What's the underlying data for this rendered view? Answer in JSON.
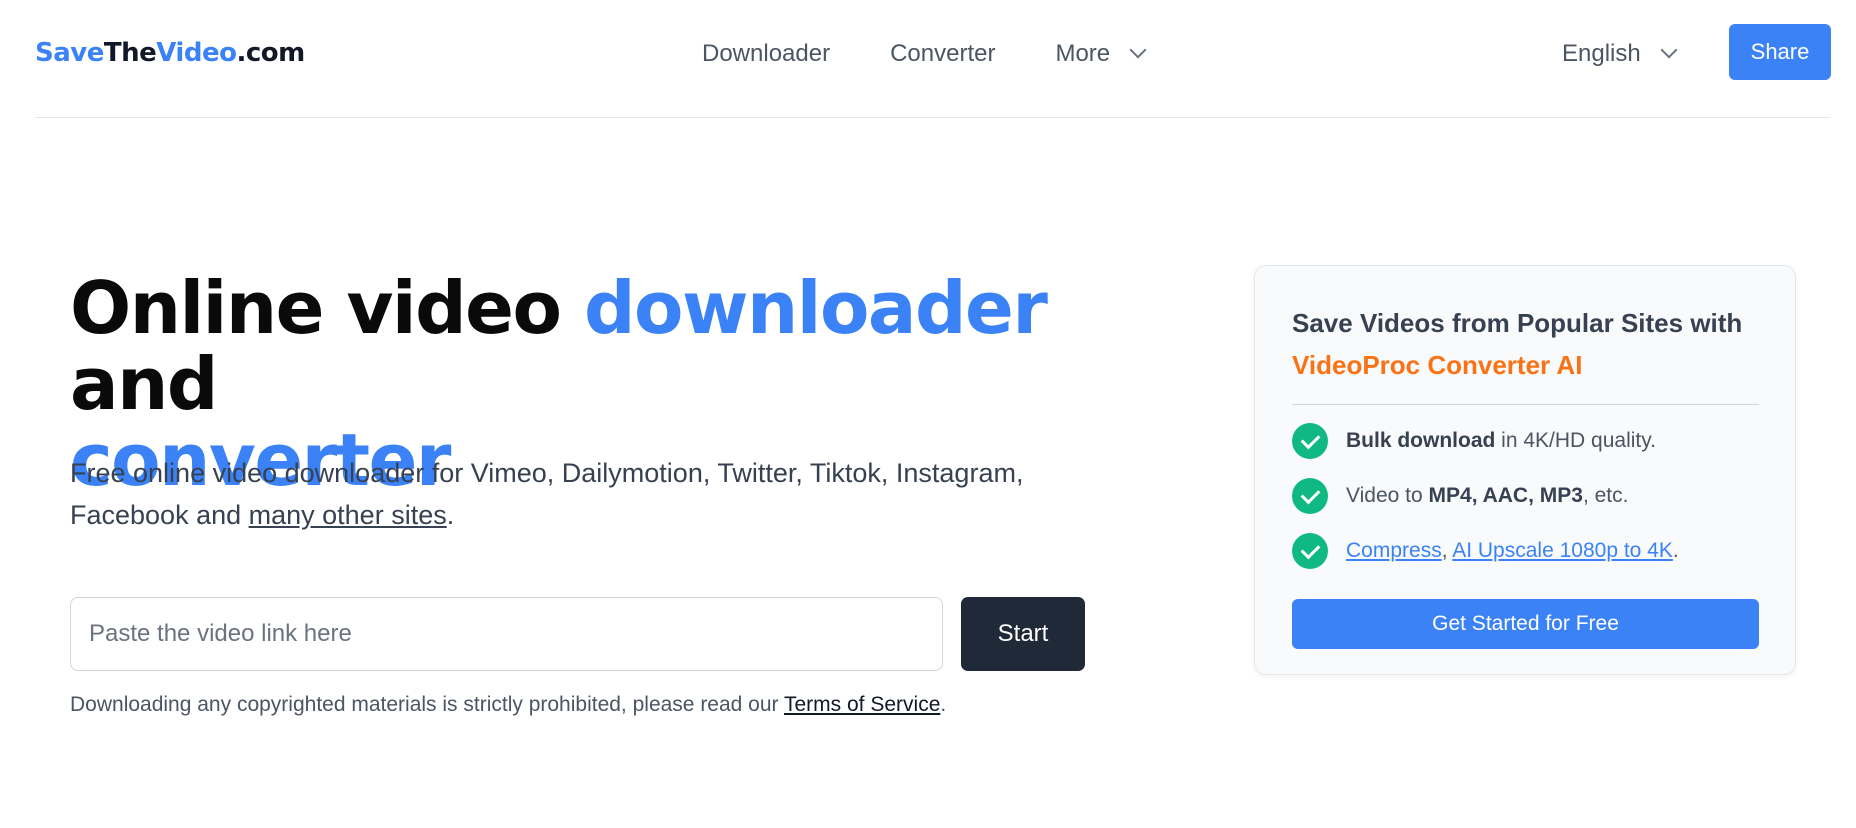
{
  "header": {
    "logo": {
      "part1": "Save",
      "part2": "The",
      "part3": "Video",
      "part4": ".com"
    },
    "nav": [
      {
        "label": "Downloader"
      },
      {
        "label": "Converter"
      },
      {
        "label": "More"
      }
    ],
    "language": "English",
    "share_label": "Share"
  },
  "hero": {
    "title_part1": "Online video ",
    "title_highlight1": "downloader",
    "title_part2": " and",
    "title_highlight2": "converter",
    "subtitle_text": "Free online video downloader for Vimeo, Dailymotion, Twitter, Tiktok, Instagram, Facebook and ",
    "subtitle_link": "many other sites",
    "subtitle_end": ".",
    "input_placeholder": "Paste the video link here",
    "input_value": "",
    "start_label": "Start",
    "disclaimer_text": "Downloading any copyrighted materials is strictly prohibited, please read our ",
    "disclaimer_link": "Terms of Service",
    "disclaimer_end": "."
  },
  "promo": {
    "title": "Save Videos from Popular Sites with",
    "brand": "VideoProc Converter AI",
    "features": [
      {
        "bold": "Bulk download",
        "text": " in 4K/HD quality."
      },
      {
        "prefix": "Video to ",
        "bold": "MP4, AAC, MP3",
        "text": ", etc."
      },
      {
        "link1": "Compress",
        "sep": ", ",
        "link2": "AI Upscale 1080p to 4K",
        "end": "."
      }
    ],
    "cta_label": "Get Started for Free"
  },
  "colors": {
    "accent": "#3b82f6",
    "dark_button": "#1f2937",
    "check_green": "#10b981",
    "brand_orange": "#f97316"
  },
  "icons": [
    "chevron-down-icon",
    "check-circle-icon"
  ]
}
